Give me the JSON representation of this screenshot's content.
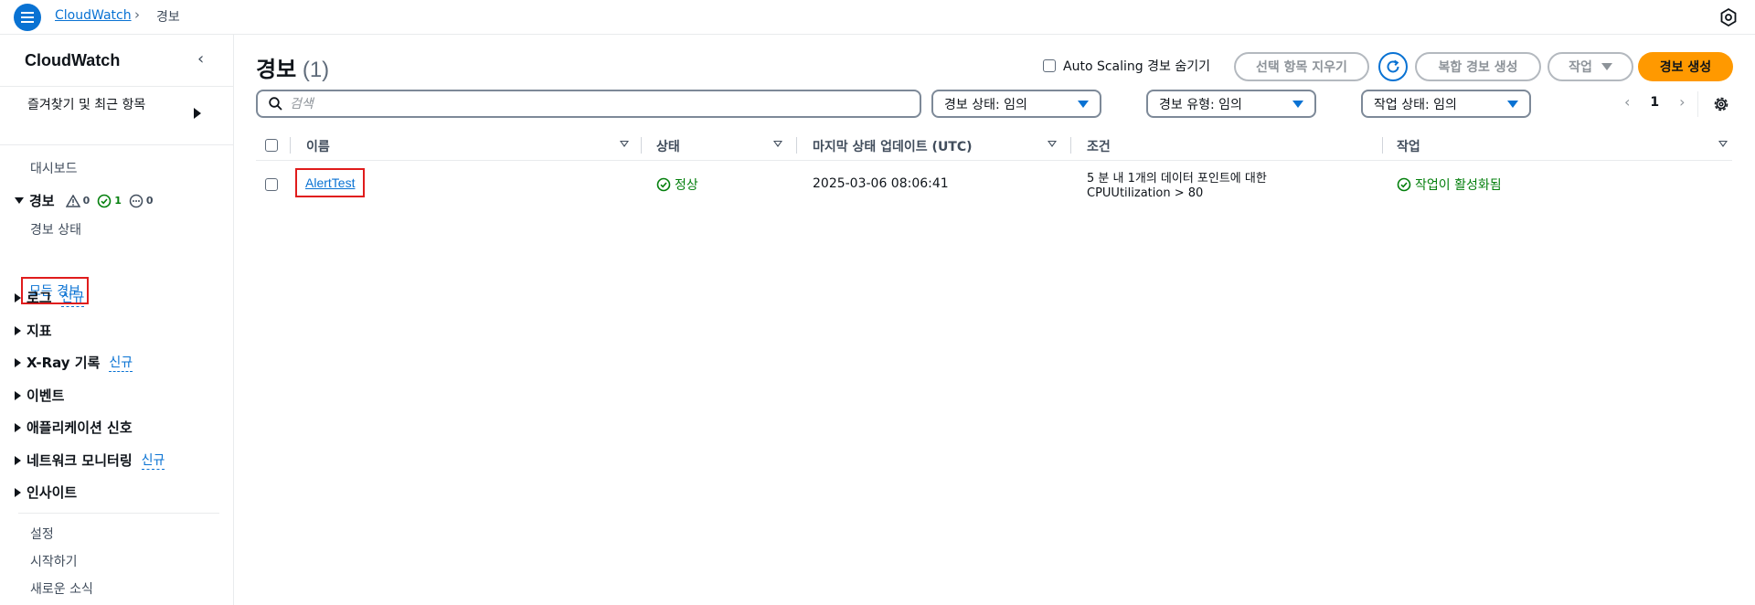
{
  "topbar": {
    "breadcrumb_root": "CloudWatch",
    "breadcrumb_current": "경보"
  },
  "sidebar": {
    "title": "CloudWatch",
    "favorites": "즐겨찾기 및 최근 항목",
    "dashboards": "대시보드",
    "alarms": {
      "label": "경보",
      "counts": {
        "in_alarm": "0",
        "ok": "1",
        "insufficient": "0"
      },
      "sub_items": [
        "경보 상태",
        "모든 경보"
      ]
    },
    "sections": [
      {
        "label": "로그",
        "new_tag": "신규"
      },
      {
        "label": "지표",
        "new_tag": ""
      },
      {
        "label": "X-Ray 기록",
        "new_tag": "신규"
      },
      {
        "label": "이벤트",
        "new_tag": ""
      },
      {
        "label": "애플리케이션 신호",
        "new_tag": ""
      },
      {
        "label": "네트워크 모니터링",
        "new_tag": "신규"
      },
      {
        "label": "인사이트",
        "new_tag": ""
      }
    ],
    "footer_items": [
      "설정",
      "시작하기",
      "새로운 소식"
    ]
  },
  "main": {
    "title": "경보",
    "count": "(1)",
    "hide_asg_label": "Auto Scaling 경보 숨기기",
    "clear_selection": "선택 항목 지우기",
    "create_composite": "복합 경보 생성",
    "actions": "작업",
    "create_alarm": "경보 생성",
    "search_placeholder": "검색",
    "filters": {
      "alarm_state": "경보 상태: 임의",
      "alarm_type": "경보 유형: 임의",
      "action_state": "작업 상태: 임의"
    },
    "page_number": "1"
  },
  "table": {
    "headers": {
      "name": "이름",
      "state": "상태",
      "last_update": "마지막 상태 업데이트 (UTC)",
      "conditions": "조건",
      "actions": "작업"
    },
    "rows": [
      {
        "name": "AlertTest",
        "state": "정상",
        "last_update": "2025-03-06 08:06:41",
        "condition_line1": "5 분 내 1개의 데이터 포인트에 대한",
        "condition_line2": "CPUUtilization > 80",
        "actions": "작업이 활성화됨"
      }
    ]
  },
  "colors": {
    "link": "#0972d3",
    "primary_button": "#ff9900",
    "ok_green": "#037f0c",
    "highlight_red": "#e01c1c"
  }
}
